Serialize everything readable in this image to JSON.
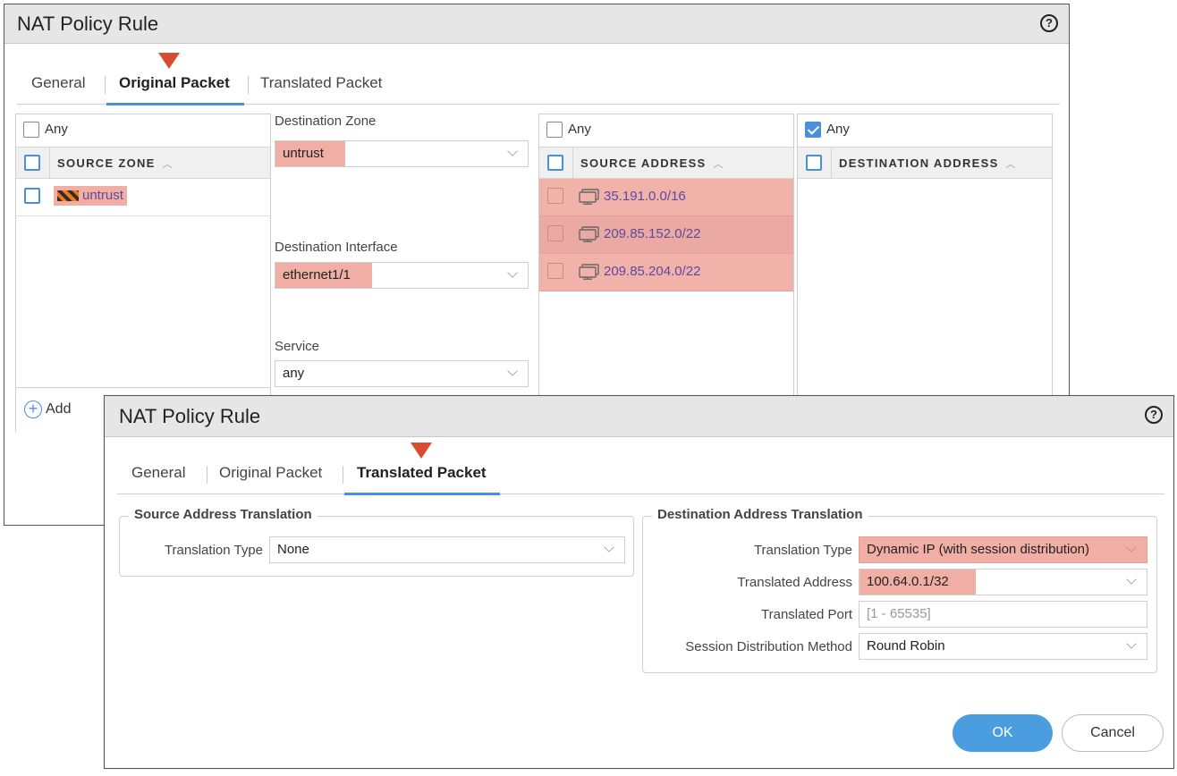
{
  "dialog1": {
    "title": "NAT Policy Rule",
    "help": "?",
    "tabs": [
      "General",
      "Original Packet",
      "Translated Packet"
    ],
    "active_tab": "Original Packet",
    "source_zone": {
      "any_label": "Any",
      "any_checked": false,
      "header": "SOURCE ZONE",
      "rows": [
        "untrust"
      ]
    },
    "destination_zone": {
      "label": "Destination Zone",
      "value": "untrust"
    },
    "destination_interface": {
      "label": "Destination Interface",
      "value": "ethernet1/1"
    },
    "service": {
      "label": "Service",
      "value": "any"
    },
    "source_address": {
      "any_label": "Any",
      "any_checked": false,
      "header": "SOURCE ADDRESS",
      "rows": [
        "35.191.0.0/16",
        "209.85.152.0/22",
        "209.85.204.0/22"
      ]
    },
    "destination_address": {
      "any_label": "Any",
      "any_checked": true,
      "header": "DESTINATION ADDRESS"
    },
    "add_label": "Add"
  },
  "dialog2": {
    "title": "NAT Policy Rule",
    "help": "?",
    "tabs": [
      "General",
      "Original Packet",
      "Translated Packet"
    ],
    "active_tab": "Translated Packet",
    "source_translation": {
      "legend": "Source Address Translation",
      "type_label": "Translation Type",
      "type_value": "None"
    },
    "destination_translation": {
      "legend": "Destination Address Translation",
      "type_label": "Translation Type",
      "type_value": "Dynamic IP (with session distribution)",
      "address_label": "Translated Address",
      "address_value": "100.64.0.1/32",
      "port_label": "Translated Port",
      "port_placeholder": "[1 - 65535]",
      "method_label": "Session Distribution Method",
      "method_value": "Round Robin"
    },
    "ok_label": "OK",
    "cancel_label": "Cancel"
  },
  "colors": {
    "highlight": "#f1aea5",
    "accent_blue": "#4a90d9",
    "marker_red": "#d94c30",
    "link_purple": "#5b4a9e"
  },
  "icons": [
    "help-icon",
    "sort-asc-icon",
    "zone-icon",
    "network-address-icon",
    "chevron-down-icon",
    "add-icon",
    "delete-icon",
    "checkmark-icon"
  ]
}
